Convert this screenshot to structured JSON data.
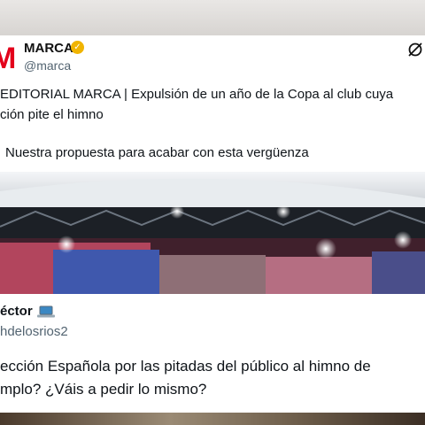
{
  "post": {
    "account_name": "MARCA",
    "handle": "@marca",
    "logo_text": "M",
    "verified_glyph": "✓",
    "text_line1": "EDITORIAL MARCA |  Expulsión de un año de la Copa al club cuya",
    "text_line2": "ción pite el himno",
    "text_line3": "Nuestra propuesta para acabar con esta vergüenza",
    "brand_color": "#e3001b",
    "verified_color": "#f0b400"
  },
  "reply": {
    "name": "éctor",
    "handle": "hdelosrios2",
    "text_line1": "ección Española por las pitadas del público al himno de",
    "text_line2": "mplo? ¿Váis a pedir lo mismo?"
  },
  "icons": {
    "x_logo": "x-logo-icon",
    "laptop": "laptop-icon",
    "verified": "verified-badge-icon"
  }
}
